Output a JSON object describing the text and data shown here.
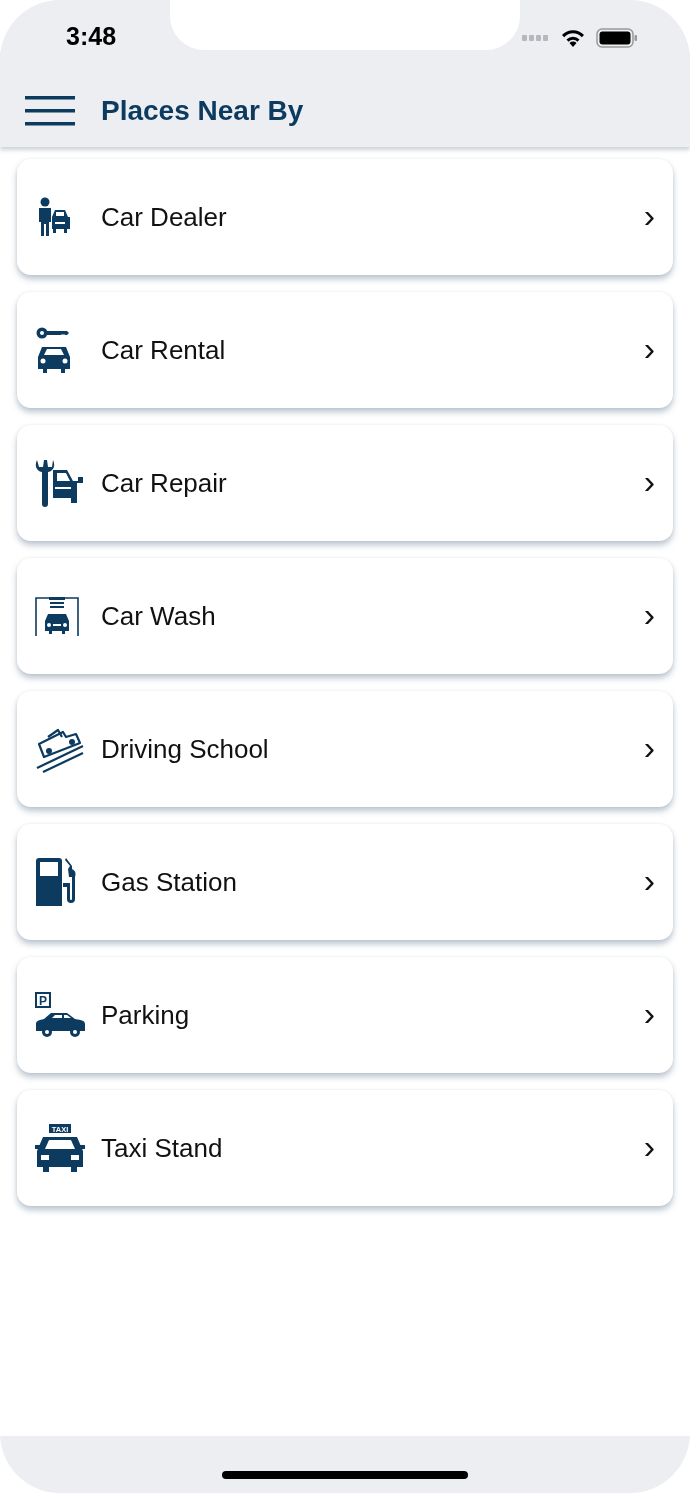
{
  "status_bar": {
    "time": "3:48"
  },
  "header": {
    "title": "Places Near By"
  },
  "places": [
    {
      "kind": "dealer",
      "label": "Car Dealer",
      "chevron": "›"
    },
    {
      "kind": "rental",
      "label": "Car Rental",
      "chevron": "›"
    },
    {
      "kind": "repair",
      "label": "Car Repair",
      "chevron": "›"
    },
    {
      "kind": "wash",
      "label": "Car Wash",
      "chevron": "›"
    },
    {
      "kind": "school",
      "label": "Driving School",
      "chevron": "›"
    },
    {
      "kind": "gas",
      "label": "Gas Station",
      "chevron": "›"
    },
    {
      "kind": "parking",
      "label": "Parking",
      "chevron": "›",
      "icon_text": "P"
    },
    {
      "kind": "taxi",
      "label": "Taxi Stand",
      "chevron": "›",
      "icon_text": "TAXI"
    }
  ]
}
